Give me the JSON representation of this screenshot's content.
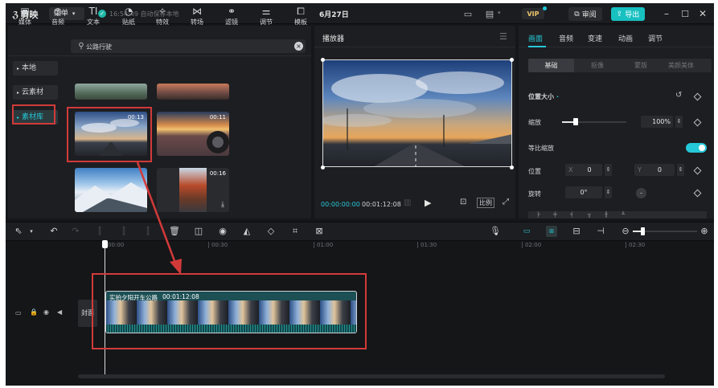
{
  "app": {
    "logo": "剪映",
    "menu_label": "菜单",
    "save_status": "16:54:49 自动保存本地",
    "project_title": "6月27日"
  },
  "header": {
    "vip_label": "VIP",
    "review_label": "审阅",
    "export_label": "导出"
  },
  "toolbar": {
    "tabs": [
      {
        "label": "媒体",
        "icon": "media-icon"
      },
      {
        "label": "音频",
        "icon": "audio-icon"
      },
      {
        "label": "文本",
        "icon": "text-icon"
      },
      {
        "label": "贴纸",
        "icon": "sticker-icon"
      },
      {
        "label": "特效",
        "icon": "effects-icon"
      },
      {
        "label": "转场",
        "icon": "transition-icon"
      },
      {
        "label": "滤镜",
        "icon": "filter-icon"
      },
      {
        "label": "调节",
        "icon": "adjust-icon"
      },
      {
        "label": "模板",
        "icon": "template-icon"
      }
    ]
  },
  "sidebar": {
    "items": [
      {
        "label": "本地"
      },
      {
        "label": "云素材"
      },
      {
        "label": "素材库"
      }
    ]
  },
  "search": {
    "value": "公路行驶"
  },
  "media": {
    "thumbs": [
      {
        "duration": "00:13"
      },
      {
        "duration": "00:11"
      },
      {
        "duration": ""
      },
      {
        "duration": "00:16"
      }
    ]
  },
  "player": {
    "title": "播放器",
    "time_current": "00:00:00:00",
    "time_total": "00:01:12:08",
    "ratio_label": "比例"
  },
  "props": {
    "tabs": [
      "画面",
      "音频",
      "变速",
      "动画",
      "调节"
    ],
    "subtabs": [
      "基础",
      "抠像",
      "蒙版",
      "美颜美体"
    ],
    "section_title": "位置大小",
    "scale_label": "缩放",
    "scale_value": "100%",
    "uniform_label": "等比缩放",
    "position_label": "位置",
    "x_label": "X",
    "x_value": "0",
    "y_label": "Y",
    "y_value": "0",
    "rotate_label": "旋转",
    "rotate_value": "0°"
  },
  "timeline": {
    "ticks": [
      "00:00",
      "00:30",
      "01:00",
      "01:30",
      "02:00",
      "02:30"
    ],
    "cover_label": "封面",
    "clip_title": "实拍夕阳开车公路",
    "clip_duration": "00:01:12:08"
  },
  "colors": {
    "accent": "#25c8d8",
    "highlight": "#d23a3a",
    "export": "#18c0c0"
  }
}
